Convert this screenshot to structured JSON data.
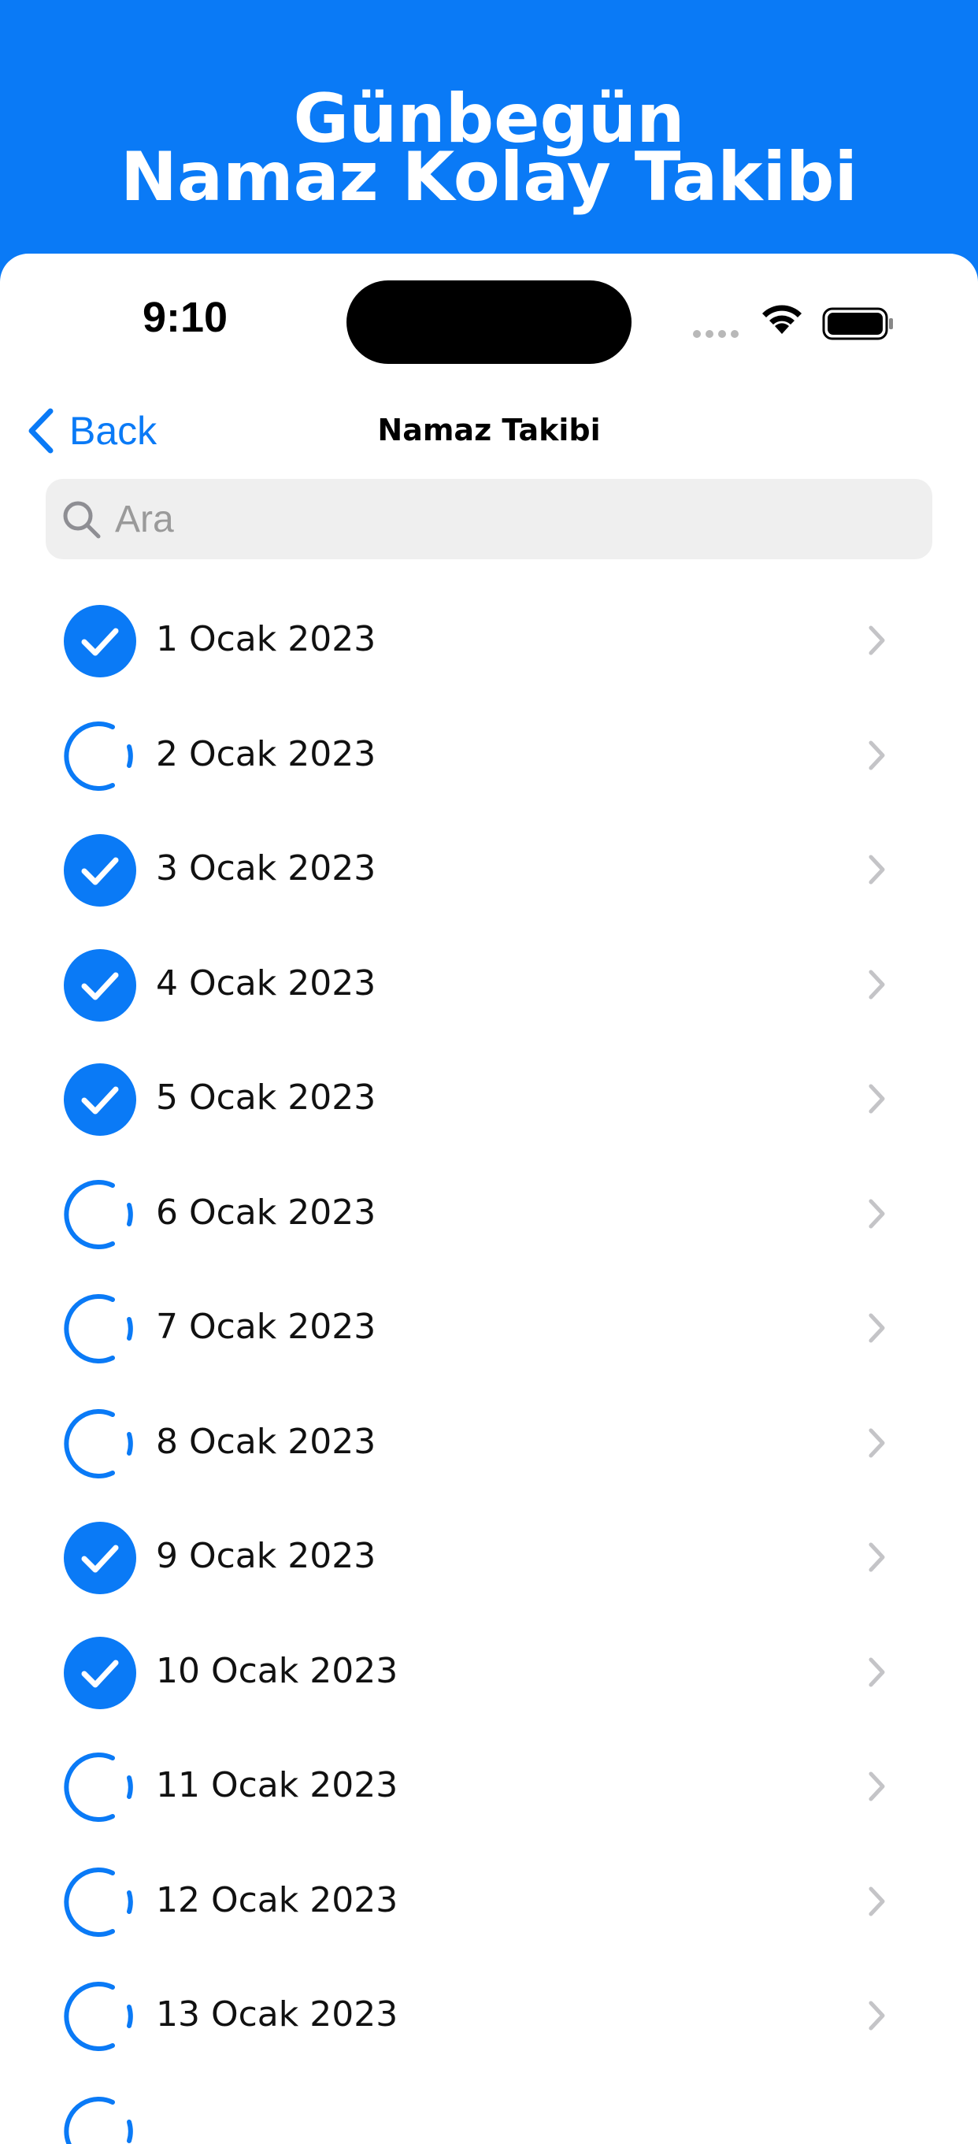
{
  "promo": {
    "line1": "Günbegün",
    "line2": "Namaz Kolay Takibi"
  },
  "status_bar": {
    "time": "9:10"
  },
  "nav": {
    "back_label": "Back",
    "title": "Namaz Takibi"
  },
  "search": {
    "placeholder": "Ara",
    "value": ""
  },
  "colors": {
    "accent": "#0A7AF6",
    "chevron": "#C4C4C7"
  },
  "days": [
    {
      "label": "1 Ocak 2023",
      "completed": true
    },
    {
      "label": "2 Ocak 2023",
      "completed": false
    },
    {
      "label": "3 Ocak 2023",
      "completed": true
    },
    {
      "label": "4 Ocak 2023",
      "completed": true
    },
    {
      "label": "5 Ocak 2023",
      "completed": true
    },
    {
      "label": "6 Ocak 2023",
      "completed": false
    },
    {
      "label": "7 Ocak 2023",
      "completed": false
    },
    {
      "label": "8 Ocak 2023",
      "completed": false
    },
    {
      "label": "9 Ocak 2023",
      "completed": true
    },
    {
      "label": "10 Ocak 2023",
      "completed": true
    },
    {
      "label": "11 Ocak 2023",
      "completed": false
    },
    {
      "label": "12 Ocak 2023",
      "completed": false
    },
    {
      "label": "13 Ocak 2023",
      "completed": false
    },
    {
      "label": "",
      "completed": false
    }
  ]
}
